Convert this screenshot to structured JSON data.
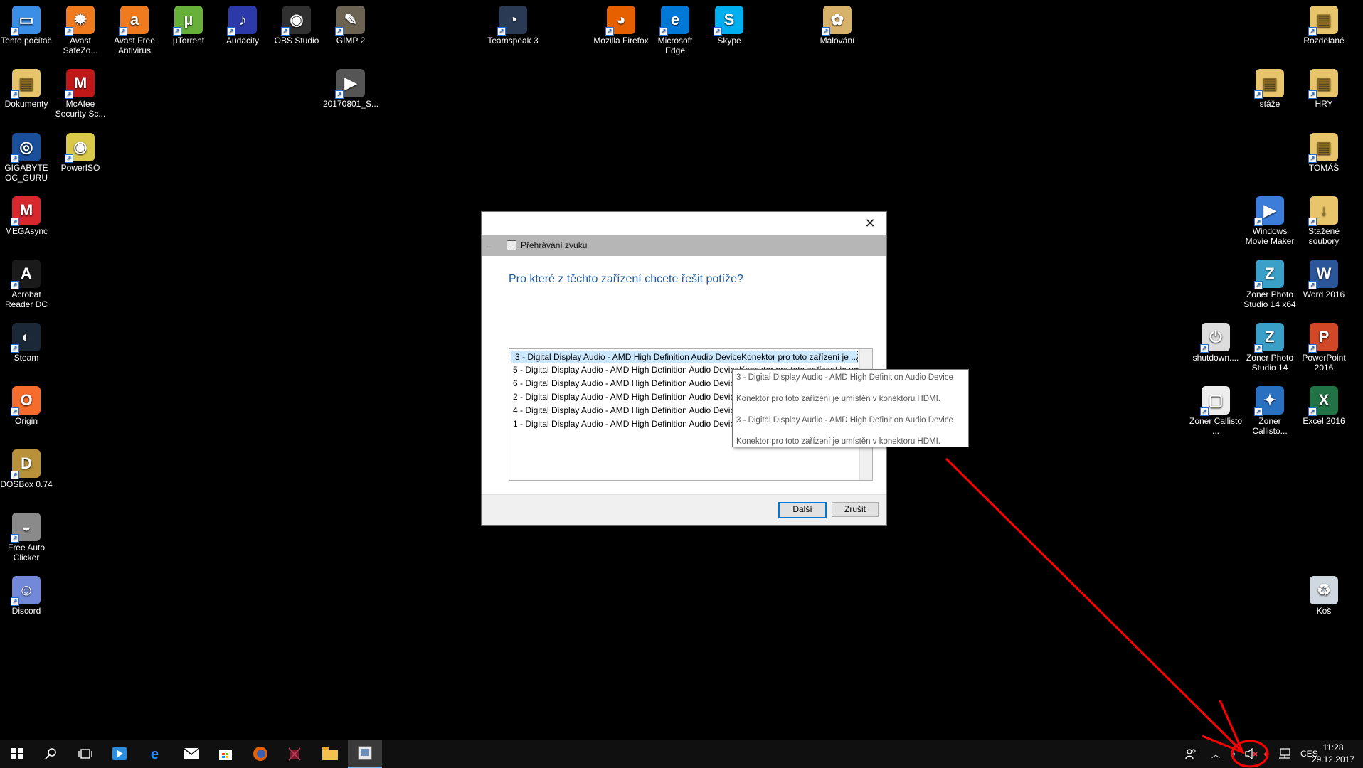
{
  "desktop": {
    "icons": [
      {
        "label": "Tento počítač",
        "icon": "computer-icon",
        "color": "#3a8ee6"
      },
      {
        "label": "Avast SafeZo...",
        "icon": "avast-safezone-icon",
        "color": "#f07b1f"
      },
      {
        "label": "Avast Free Antivirus",
        "icon": "avast-icon",
        "color": "#f07b1f"
      },
      {
        "label": "µTorrent",
        "icon": "utorrent-icon",
        "color": "#67b13a"
      },
      {
        "label": "Audacity",
        "icon": "audacity-icon",
        "color": "#2b3aa8"
      },
      {
        "label": "OBS Studio",
        "icon": "obs-icon",
        "color": "#303030"
      },
      {
        "label": "GIMP 2",
        "icon": "gimp-icon",
        "color": "#6d6353"
      },
      {
        "label": "Dokumenty",
        "icon": "folder-icon",
        "color": "#e8c56b"
      },
      {
        "label": "McAfee Security Sc...",
        "icon": "mcafee-icon",
        "color": "#c01818"
      },
      {
        "label": "20170801_S...",
        "icon": "video-file-icon",
        "color": "#555555"
      },
      {
        "label": "GIGABYTE OC_GURU",
        "icon": "gigabyte-icon",
        "color": "#1a4f9c"
      },
      {
        "label": "PowerISO",
        "icon": "poweriso-icon",
        "color": "#d9c84a"
      },
      {
        "label": "MEGAsync",
        "icon": "mega-icon",
        "color": "#d9272e"
      },
      {
        "label": "Acrobat Reader DC",
        "icon": "acrobat-icon",
        "color": "#1a1a1a"
      },
      {
        "label": "Steam",
        "icon": "steam-icon",
        "color": "#1b2838"
      },
      {
        "label": "Origin",
        "icon": "origin-icon",
        "color": "#f56c2d"
      },
      {
        "label": "DOSBox 0.74",
        "icon": "dosbox-icon",
        "color": "#b8913a"
      },
      {
        "label": "Free Auto Clicker",
        "icon": "mouse-icon",
        "color": "#8a8a8a"
      },
      {
        "label": "Discord",
        "icon": "discord-icon",
        "color": "#7289da"
      },
      {
        "label": "Teamspeak 3",
        "icon": "teamspeak-icon",
        "color": "#2a3a55"
      },
      {
        "label": "Mozilla Firefox",
        "icon": "firefox-icon",
        "color": "#e66000"
      },
      {
        "label": "Microsoft Edge",
        "icon": "edge-icon",
        "color": "#0078d7"
      },
      {
        "label": "Skype",
        "icon": "skype-icon",
        "color": "#00aff0"
      },
      {
        "label": "Malování",
        "icon": "paint-icon",
        "color": "#d8b26a"
      },
      {
        "label": "Rozdělané",
        "icon": "folder-icon",
        "color": "#e8c56b"
      },
      {
        "label": "stáže",
        "icon": "folder-icon",
        "color": "#e8c56b"
      },
      {
        "label": "HRY",
        "icon": "folder-icon",
        "color": "#e8c56b"
      },
      {
        "label": "TOMÁŠ",
        "icon": "folder-icon",
        "color": "#e8c56b"
      },
      {
        "label": "Windows Movie Maker",
        "icon": "movie-maker-icon",
        "color": "#3b7dd8"
      },
      {
        "label": "Stažené soubory",
        "icon": "downloads-folder-icon",
        "color": "#e8c56b"
      },
      {
        "label": "Zoner Photo Studio 14 x64",
        "icon": "zoner-icon",
        "color": "#3aa0c8"
      },
      {
        "label": "Word 2016",
        "icon": "word-icon",
        "color": "#2b579a"
      },
      {
        "label": "shutdown....",
        "icon": "shutdown-icon",
        "color": "#dddddd"
      },
      {
        "label": "Zoner Photo Studio 14",
        "icon": "zoner-icon",
        "color": "#3aa0c8"
      },
      {
        "label": "PowerPoint 2016",
        "icon": "powerpoint-icon",
        "color": "#d24726"
      },
      {
        "label": "Zoner Callisto ...",
        "icon": "callisto-icon",
        "color": "#eeeeee"
      },
      {
        "label": "Zoner Callisto...",
        "icon": "callisto-parrot-icon",
        "color": "#2a70c0"
      },
      {
        "label": "Excel 2016",
        "icon": "excel-icon",
        "color": "#217346"
      },
      {
        "label": "Koš",
        "icon": "recycle-bin-icon",
        "color": "#cfd8e0"
      }
    ]
  },
  "dialog": {
    "app_title": "Přehrávání zvuku",
    "heading": "Pro které z těchto zařízení chcete řešit potíže?",
    "devices": [
      "3 - Digital Display Audio - AMD High Definition Audio DeviceKonektor pro toto zařízení je ...",
      "5 - Digital Display Audio - AMD High Definition Audio DeviceKonektor pro toto zařízení je umístěn v konektoru HDMI.",
      "6 - Digital Display Audio - AMD High Definition Audio Device",
      "2 - Digital Display Audio - AMD High Definition Audio Device",
      "4 - Digital Display Audio - AMD High Definition Audio Device",
      "1 - Digital Display Audio - AMD High Definition Audio Device"
    ],
    "next_label": "Další",
    "cancel_label": "Zrušit"
  },
  "tooltip": {
    "lines": [
      "3 - Digital Display Audio - AMD High Definition Audio Device",
      "Konektor pro toto zařízení je umístěn v konektoru HDMI.",
      "3 - Digital Display Audio - AMD High Definition Audio Device",
      "Konektor pro toto zařízení je umístěn v konektoru HDMI."
    ]
  },
  "taskbar": {
    "buttons": [
      "start-icon",
      "search-icon",
      "task-view-icon",
      "media-player-icon",
      "edge-icon",
      "mail-icon",
      "store-icon",
      "firefox-icon",
      "game-icon",
      "file-explorer-icon",
      "troubleshooter-icon"
    ],
    "language": "CES",
    "time": "11:28",
    "date": "29.12.2017"
  },
  "colors": {
    "accent": "#0078d7",
    "annotation": "#ff0000",
    "heading": "#1c5aa0"
  }
}
